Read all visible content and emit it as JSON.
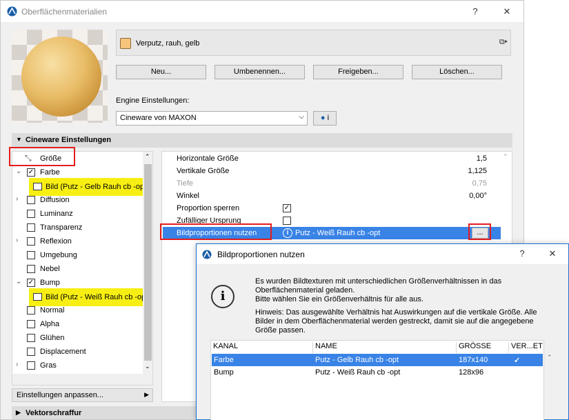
{
  "window": {
    "title": "Oberflächenmaterialien",
    "help": "?",
    "close": "✕"
  },
  "material": {
    "name": "Verputz, rauh, gelb",
    "swatch_color": "#f7c47c"
  },
  "buttons": {
    "new": "Neu...",
    "rename": "Umbenennen...",
    "share": "Freigeben...",
    "delete": "Löschen..."
  },
  "engine": {
    "label": "Engine Einstellungen:",
    "value": "Cineware von MAXON",
    "info": "i"
  },
  "sections": {
    "cineware": "Cineware Einstellungen",
    "vector": "Vektorschraffur"
  },
  "channels": [
    {
      "label": "Größe",
      "checked": null
    },
    {
      "label": "Farbe",
      "checked": true,
      "texture": "Bild (Putz - Gelb Rauh cb -opt"
    },
    {
      "label": "Diffusion",
      "checked": false
    },
    {
      "label": "Luminanz",
      "checked": false
    },
    {
      "label": "Transparenz",
      "checked": false
    },
    {
      "label": "Reflexion",
      "checked": false
    },
    {
      "label": "Umgebung",
      "checked": false
    },
    {
      "label": "Nebel",
      "checked": false
    },
    {
      "label": "Bump",
      "checked": true,
      "texture": "Bild (Putz - Weiß Rauh cb -opt"
    },
    {
      "label": "Normal",
      "checked": false
    },
    {
      "label": "Alpha",
      "checked": false
    },
    {
      "label": "Glühen",
      "checked": false
    },
    {
      "label": "Displacement",
      "checked": false
    },
    {
      "label": "Gras",
      "checked": false
    }
  ],
  "customize": {
    "label": "Einstellungen anpassen..."
  },
  "params": [
    {
      "label": "Horizontale Größe",
      "value": "1,5"
    },
    {
      "label": "Vertikale Größe",
      "value": "1,125"
    },
    {
      "label": "Tiefe",
      "value": "0,75",
      "disabled": true
    },
    {
      "label": "Winkel",
      "value": "0,00°"
    },
    {
      "label": "Proportion sperren",
      "checked": true
    },
    {
      "label": "Zufälliger Ursprung",
      "checked": false
    },
    {
      "label": "Bildproportionen nutzen",
      "value": "Putz - Weiß Rauh cb -opt",
      "button": "...",
      "selected": true
    }
  ],
  "dialog": {
    "title": "Bildproportionen nutzen",
    "help": "?",
    "close": "✕",
    "msg1": "Es wurden Bildtexturen mit unterschiedlichen Größenverhältnissen in das Oberflächenmaterial geladen.",
    "msg2": "Bitte wählen Sie ein Größenverhältnis für alle aus.",
    "msg3": "Hinweis: Das ausgewählte Verhältnis hat Auswirkungen auf die vertikale Größe. Alle Bilder in dem Oberflächenmaterial werden gestreckt, damit sie auf die angegebene Größe passen.",
    "columns": {
      "channel": "KANAL",
      "name": "NAME",
      "size": "GRÖSSE",
      "ratio": "VER...ET"
    },
    "rows": [
      {
        "channel": "Farbe",
        "name": "Putz - Gelb Rauh cb -opt",
        "size": "187x140",
        "ratio": "✓"
      },
      {
        "channel": "Bump",
        "name": "Putz - Weiß Rauh cb -opt",
        "size": "128x96",
        "ratio": ""
      }
    ]
  }
}
